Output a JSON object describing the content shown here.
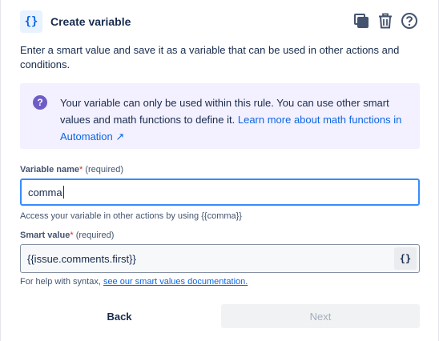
{
  "header": {
    "icon_text": "{}",
    "title": "Create variable",
    "icons": [
      "duplicate-icon",
      "trash-icon",
      "help-icon"
    ]
  },
  "description": "Enter a smart value and save it as a variable that can be used in other actions and conditions.",
  "info": {
    "icon": "?",
    "text": "Your variable can only be used within this rule. You can use other smart values and math functions to define it. ",
    "link": "Learn more about math functions in Automation ↗",
    "bg_color": "#f3f0ff"
  },
  "variable_name": {
    "label": "Variable name",
    "required_mark": "*",
    "required_text": "(required)",
    "value": "comma",
    "help": "Access your variable in other actions by using {{comma}}"
  },
  "smart_value": {
    "label": "Smart value",
    "required_mark": "*",
    "required_text": "(required)",
    "value": "{{issue.comments.first}}",
    "button": "{}",
    "help_prefix": "For help with syntax, ",
    "help_link": "see our smart values documentation."
  },
  "footer": {
    "back": "Back",
    "next": "Next"
  }
}
